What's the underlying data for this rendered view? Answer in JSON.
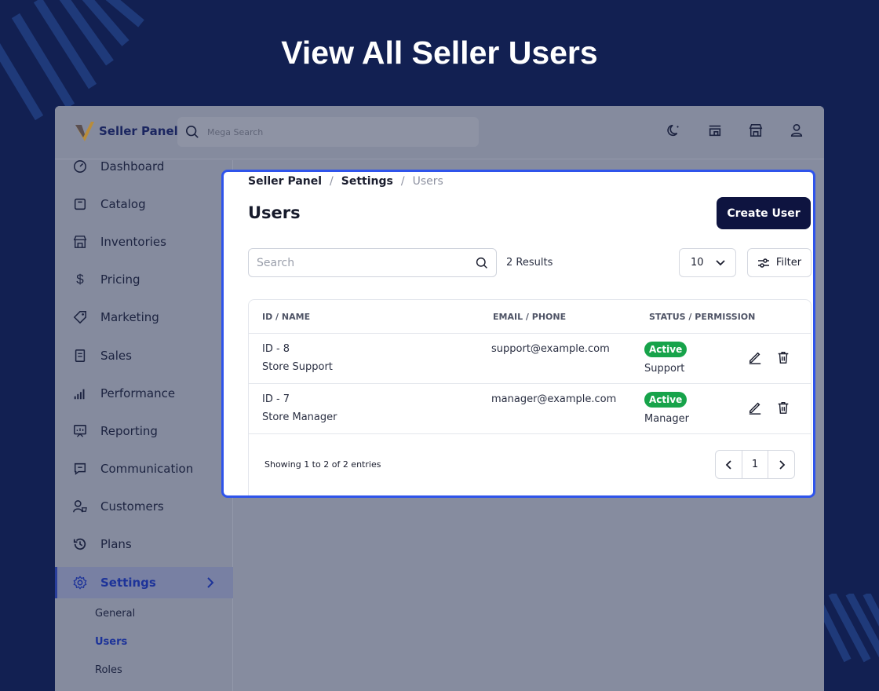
{
  "hero": {
    "title": "View All Seller Users"
  },
  "colors": {
    "background": "#122052",
    "accent": "#2f54eb",
    "active_badge": "#17a34a",
    "primary_button": "#0e1440"
  },
  "topbar": {
    "logo_text": "Seller Panel",
    "search_placeholder": "Mega Search",
    "icons": [
      "theme-toggle-icon",
      "store-front-icon",
      "shop-icon",
      "user-icon"
    ]
  },
  "sidebar": {
    "items": [
      {
        "label": "Dashboard",
        "icon": "dashboard-icon"
      },
      {
        "label": "Catalog",
        "icon": "catalog-icon"
      },
      {
        "label": "Inventories",
        "icon": "inventory-icon"
      },
      {
        "label": "Pricing",
        "icon": "dollar-icon"
      },
      {
        "label": "Marketing",
        "icon": "tag-icon"
      },
      {
        "label": "Sales",
        "icon": "receipt-icon"
      },
      {
        "label": "Performance",
        "icon": "bar-chart-icon"
      },
      {
        "label": "Reporting",
        "icon": "report-icon"
      },
      {
        "label": "Communication",
        "icon": "chat-icon"
      },
      {
        "label": "Customers",
        "icon": "customers-icon"
      },
      {
        "label": "Plans",
        "icon": "history-icon"
      },
      {
        "label": "Settings",
        "icon": "gear-icon",
        "active": true
      }
    ],
    "settings_sub": [
      {
        "label": "General"
      },
      {
        "label": "Users",
        "active": true
      },
      {
        "label": "Roles"
      }
    ]
  },
  "main": {
    "breadcrumb": [
      "Seller Panel",
      "Settings",
      "Users"
    ],
    "title": "Users",
    "create_button": "Create User",
    "search_placeholder": "Search",
    "results": "2 Results",
    "per_page": "10",
    "filter_label": "Filter",
    "columns": [
      "ID / NAME",
      "EMAIL / PHONE",
      "STATUS / PERMISSION"
    ],
    "rows": [
      {
        "id": "ID - 8",
        "name": "Store Support",
        "email": "support@example.com",
        "status": "Active",
        "permission": "Support"
      },
      {
        "id": "ID - 7",
        "name": "Store Manager",
        "email": "manager@example.com",
        "status": "Active",
        "permission": "Manager"
      }
    ],
    "showing": "Showing 1 to 2 of 2 entries",
    "page": "1"
  }
}
